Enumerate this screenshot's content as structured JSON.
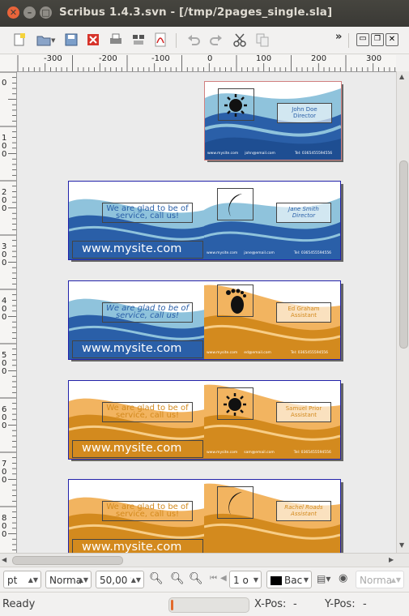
{
  "window": {
    "title": "Scribus 1.4.3.svn - [/tmp/2pages_single.sla]"
  },
  "toolbar": {
    "icons": [
      "new-document-icon",
      "open-icon",
      "save-icon",
      "close-document-icon",
      "print-icon",
      "preflight-icon",
      "export-pdf-icon",
      "undo-icon",
      "redo-icon",
      "cut-icon",
      "copy-icon",
      "more-icon",
      "select-icon",
      "more-icon-2",
      "minimize-doc-icon",
      "restore-doc-icon",
      "close-doc-icon"
    ],
    "overflow1": "»",
    "overflow2": "»"
  },
  "ruler_top": {
    "labels": [
      "-300",
      "-200",
      "-100",
      "0",
      "100",
      "200",
      "300"
    ]
  },
  "ruler_left": {
    "labels": [
      "0",
      "1",
      "0",
      "0",
      "2",
      "0",
      "0",
      "3",
      "0",
      "0",
      "4",
      "0",
      "0",
      "5",
      "0",
      "0",
      "6",
      "0",
      "0",
      "7",
      "0",
      "0",
      "8",
      "0",
      "0"
    ]
  },
  "cards": {
    "single": {
      "name_line1": "John Doe",
      "name_line2": "Director",
      "website": "www.mysite.com",
      "email": "john@email.com",
      "tel": "Tel: 0365455594556"
    },
    "rows": [
      {
        "left_text": "We are glad to be of service, call us!",
        "site": "www.mysite.com",
        "name_line1": "Jane Smith",
        "name_line2": "Director",
        "email": "jane@email.com",
        "tel": "Tel: 0365455594556"
      },
      {
        "left_text": "We are glad to be of service, call us!",
        "site": "www.mysite.com",
        "name_line1": "Ed Graham",
        "name_line2": "Assistant",
        "email": "ed@email.com",
        "tel": "Tel: 0365455594556"
      },
      {
        "left_text": "We are glad to be of service, call us!",
        "site": "www.mysite.com",
        "name_line1": "Samuel Prior",
        "name_line2": "Assistant",
        "email": "sam@email.com",
        "tel": "Tel: 0365455594556"
      },
      {
        "left_text": "We are glad to be of service, call us!",
        "site": "www.mysite.com",
        "name_line1": "Rachel Roads",
        "name_line2": "Assistant",
        "email": "",
        "tel": ""
      }
    ],
    "small_site": "www.mysite.com"
  },
  "bottombar": {
    "unit": "pt",
    "mode": "Norma",
    "zoom": "50,00 %",
    "page": "1 o",
    "color_label": "Bac",
    "view_mode": "Norma"
  },
  "status": {
    "text": "Ready",
    "xpos_label": "X-Pos:",
    "xpos_value": "-",
    "ypos_label": "Y-Pos:",
    "ypos_value": "-"
  },
  "colors": {
    "blue_dark": "#2a5fa8",
    "blue_light": "#8fc3dc",
    "orange_dark": "#d38a1e",
    "orange_light": "#f2b460",
    "title_bg": "#3c3b37"
  }
}
